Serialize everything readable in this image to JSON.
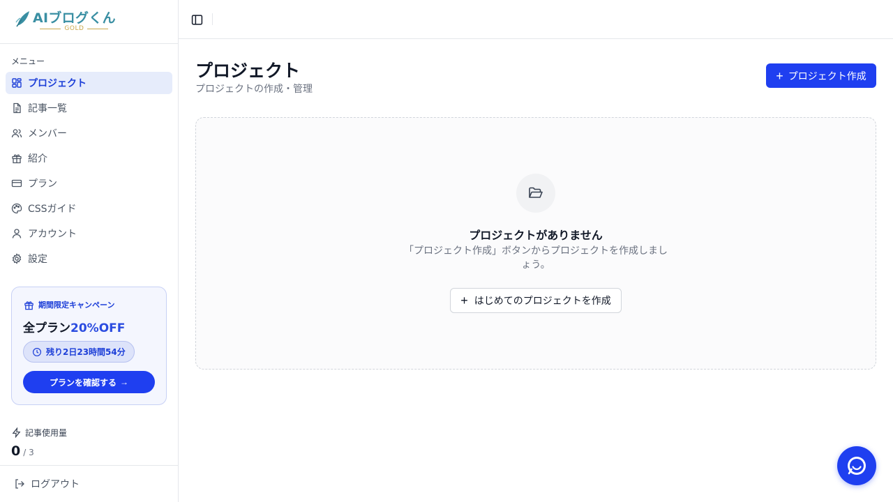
{
  "brand": {
    "title": "AIブログくん",
    "tier": "GOLD"
  },
  "sidebar": {
    "menu_label": "メニュー",
    "items": [
      {
        "label": "プロジェクト",
        "icon": "grid-icon",
        "active": true
      },
      {
        "label": "記事一覧",
        "icon": "document-icon",
        "active": false
      },
      {
        "label": "メンバー",
        "icon": "users-icon",
        "active": false
      },
      {
        "label": "紹介",
        "icon": "gift-icon",
        "active": false
      },
      {
        "label": "プラン",
        "icon": "credit-card-icon",
        "active": false
      },
      {
        "label": "CSSガイド",
        "icon": "palette-icon",
        "active": false
      },
      {
        "label": "アカウント",
        "icon": "user-icon",
        "active": false
      },
      {
        "label": "設定",
        "icon": "gear-icon",
        "active": false
      }
    ],
    "campaign": {
      "heading": "期間限定キャンペーン",
      "title_prefix": "全プラン",
      "title_highlight": "20%OFF",
      "countdown": "残り2日23時間54分",
      "button_label": "プランを確認する"
    },
    "usage": {
      "label": "記事使用量",
      "used": "0",
      "limit": "/ 3"
    },
    "logout_label": "ログアウト"
  },
  "main": {
    "title": "プロジェクト",
    "subtitle": "プロジェクトの作成・管理",
    "create_button": "プロジェクト作成",
    "empty": {
      "title": "プロジェクトがありません",
      "description": "「プロジェクト作成」ボタンからプロジェクトを作成しましょう。",
      "button": "はじめてのプロジェクトを作成"
    }
  },
  "colors": {
    "accent": "#1f3ff0",
    "active_bg": "#e6ecfb",
    "logo": "#3a8fa3",
    "gold": "#c9a84a"
  }
}
